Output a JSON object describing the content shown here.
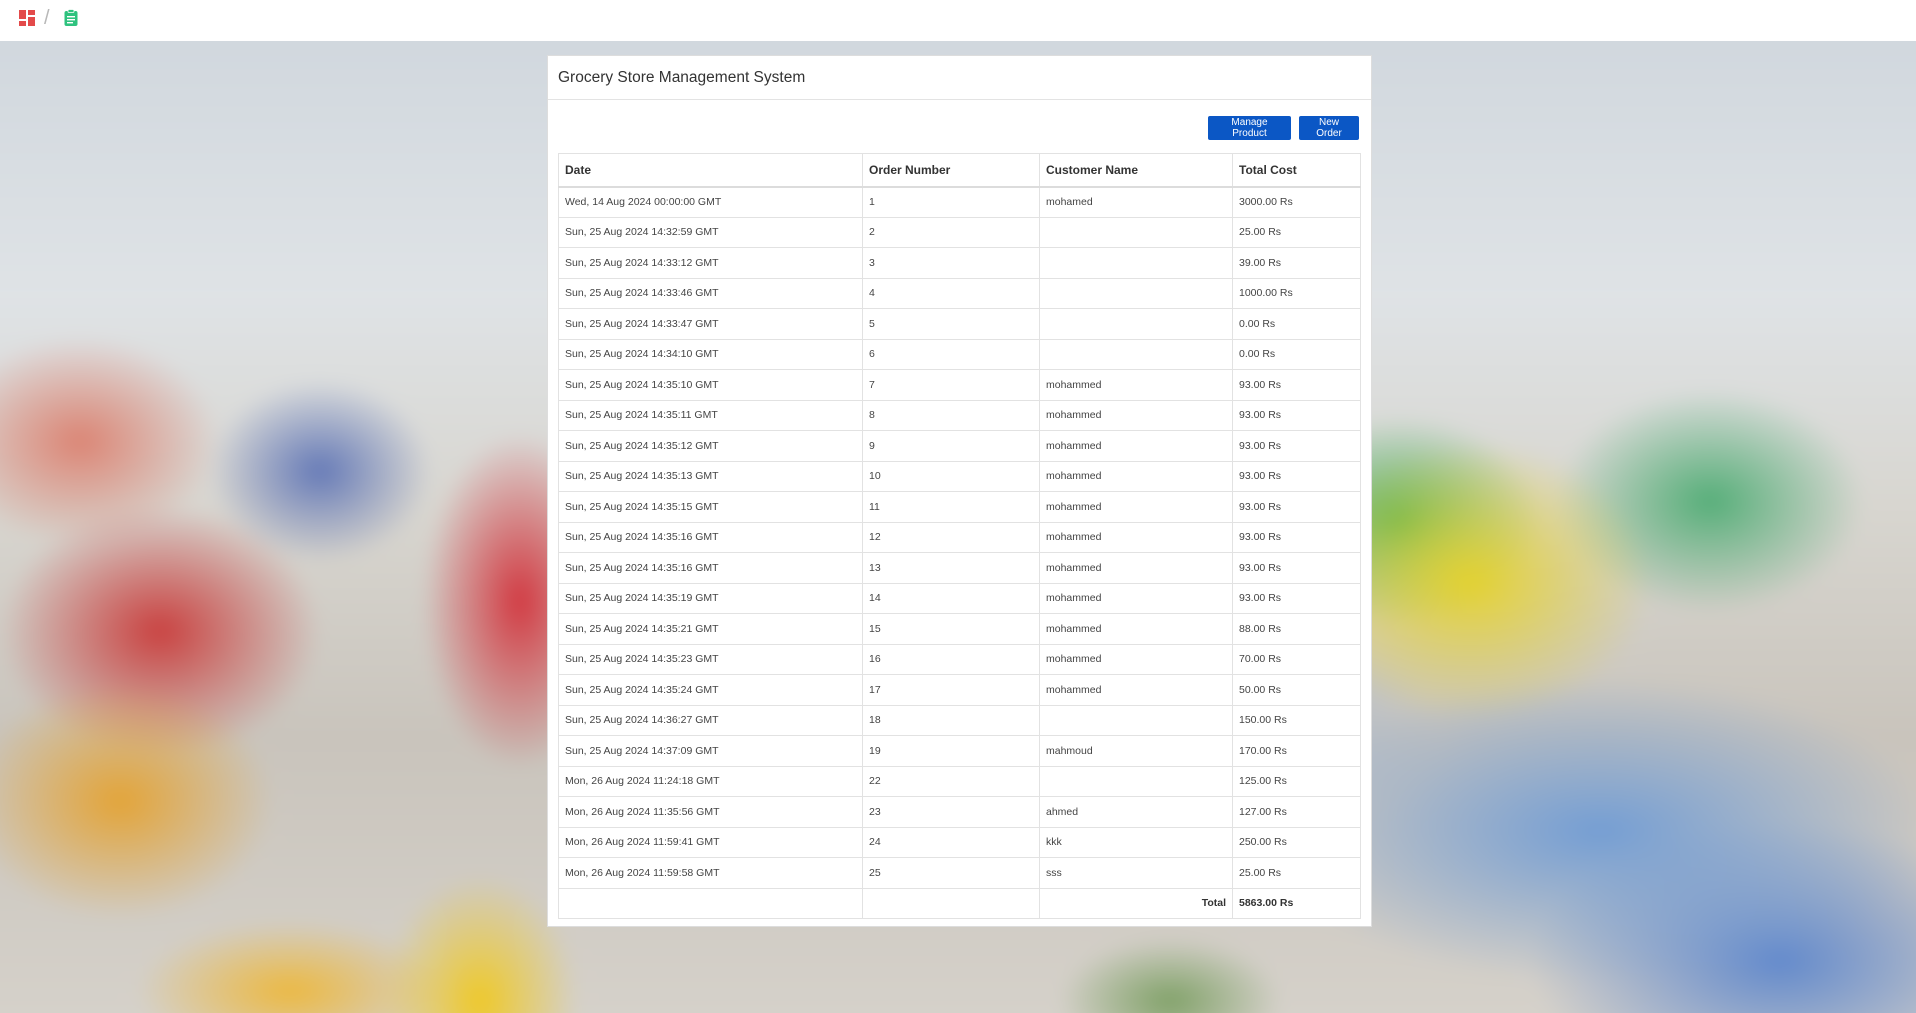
{
  "app": {
    "title": "Grocery Store Management System"
  },
  "nav": {
    "breadcrumb_separator": "/",
    "icons": [
      "dashboard-icon",
      "clipboard-icon"
    ]
  },
  "toolbar": {
    "manage_product_label": "Manage Product",
    "new_order_label": "New Order"
  },
  "orders": {
    "columns": [
      "Date",
      "Order Number",
      "Customer Name",
      "Total Cost"
    ],
    "rows": [
      {
        "date": "Wed, 14 Aug 2024 00:00:00 GMT",
        "order_number": "1",
        "customer": "mohamed",
        "total": "3000.00 Rs"
      },
      {
        "date": "Sun, 25 Aug 2024 14:32:59 GMT",
        "order_number": "2",
        "customer": "",
        "total": "25.00 Rs"
      },
      {
        "date": "Sun, 25 Aug 2024 14:33:12 GMT",
        "order_number": "3",
        "customer": "",
        "total": "39.00 Rs"
      },
      {
        "date": "Sun, 25 Aug 2024 14:33:46 GMT",
        "order_number": "4",
        "customer": "",
        "total": "1000.00 Rs"
      },
      {
        "date": "Sun, 25 Aug 2024 14:33:47 GMT",
        "order_number": "5",
        "customer": "",
        "total": "0.00 Rs"
      },
      {
        "date": "Sun, 25 Aug 2024 14:34:10 GMT",
        "order_number": "6",
        "customer": "",
        "total": "0.00 Rs"
      },
      {
        "date": "Sun, 25 Aug 2024 14:35:10 GMT",
        "order_number": "7",
        "customer": "mohammed",
        "total": "93.00 Rs"
      },
      {
        "date": "Sun, 25 Aug 2024 14:35:11 GMT",
        "order_number": "8",
        "customer": "mohammed",
        "total": "93.00 Rs"
      },
      {
        "date": "Sun, 25 Aug 2024 14:35:12 GMT",
        "order_number": "9",
        "customer": "mohammed",
        "total": "93.00 Rs"
      },
      {
        "date": "Sun, 25 Aug 2024 14:35:13 GMT",
        "order_number": "10",
        "customer": "mohammed",
        "total": "93.00 Rs"
      },
      {
        "date": "Sun, 25 Aug 2024 14:35:15 GMT",
        "order_number": "11",
        "customer": "mohammed",
        "total": "93.00 Rs"
      },
      {
        "date": "Sun, 25 Aug 2024 14:35:16 GMT",
        "order_number": "12",
        "customer": "mohammed",
        "total": "93.00 Rs"
      },
      {
        "date": "Sun, 25 Aug 2024 14:35:16 GMT",
        "order_number": "13",
        "customer": "mohammed",
        "total": "93.00 Rs"
      },
      {
        "date": "Sun, 25 Aug 2024 14:35:19 GMT",
        "order_number": "14",
        "customer": "mohammed",
        "total": "93.00 Rs"
      },
      {
        "date": "Sun, 25 Aug 2024 14:35:21 GMT",
        "order_number": "15",
        "customer": "mohammed",
        "total": "88.00 Rs"
      },
      {
        "date": "Sun, 25 Aug 2024 14:35:23 GMT",
        "order_number": "16",
        "customer": "mohammed",
        "total": "70.00 Rs"
      },
      {
        "date": "Sun, 25 Aug 2024 14:35:24 GMT",
        "order_number": "17",
        "customer": "mohammed",
        "total": "50.00 Rs"
      },
      {
        "date": "Sun, 25 Aug 2024 14:36:27 GMT",
        "order_number": "18",
        "customer": "",
        "total": "150.00 Rs"
      },
      {
        "date": "Sun, 25 Aug 2024 14:37:09 GMT",
        "order_number": "19",
        "customer": "mahmoud",
        "total": "170.00 Rs"
      },
      {
        "date": "Mon, 26 Aug 2024 11:24:18 GMT",
        "order_number": "22",
        "customer": "",
        "total": "125.00 Rs"
      },
      {
        "date": "Mon, 26 Aug 2024 11:35:56 GMT",
        "order_number": "23",
        "customer": "ahmed",
        "total": "127.00 Rs"
      },
      {
        "date": "Mon, 26 Aug 2024 11:59:41 GMT",
        "order_number": "24",
        "customer": "kkk",
        "total": "250.00 Rs"
      },
      {
        "date": "Mon, 26 Aug 2024 11:59:58 GMT",
        "order_number": "25",
        "customer": "sss",
        "total": "25.00 Rs"
      }
    ],
    "total_label": "Total",
    "total_value": "5863.00 Rs"
  },
  "colors": {
    "primary_button": "#0b57c5",
    "dashboard_icon": "#e34a4a",
    "clipboard_icon": "#2ec27e"
  }
}
